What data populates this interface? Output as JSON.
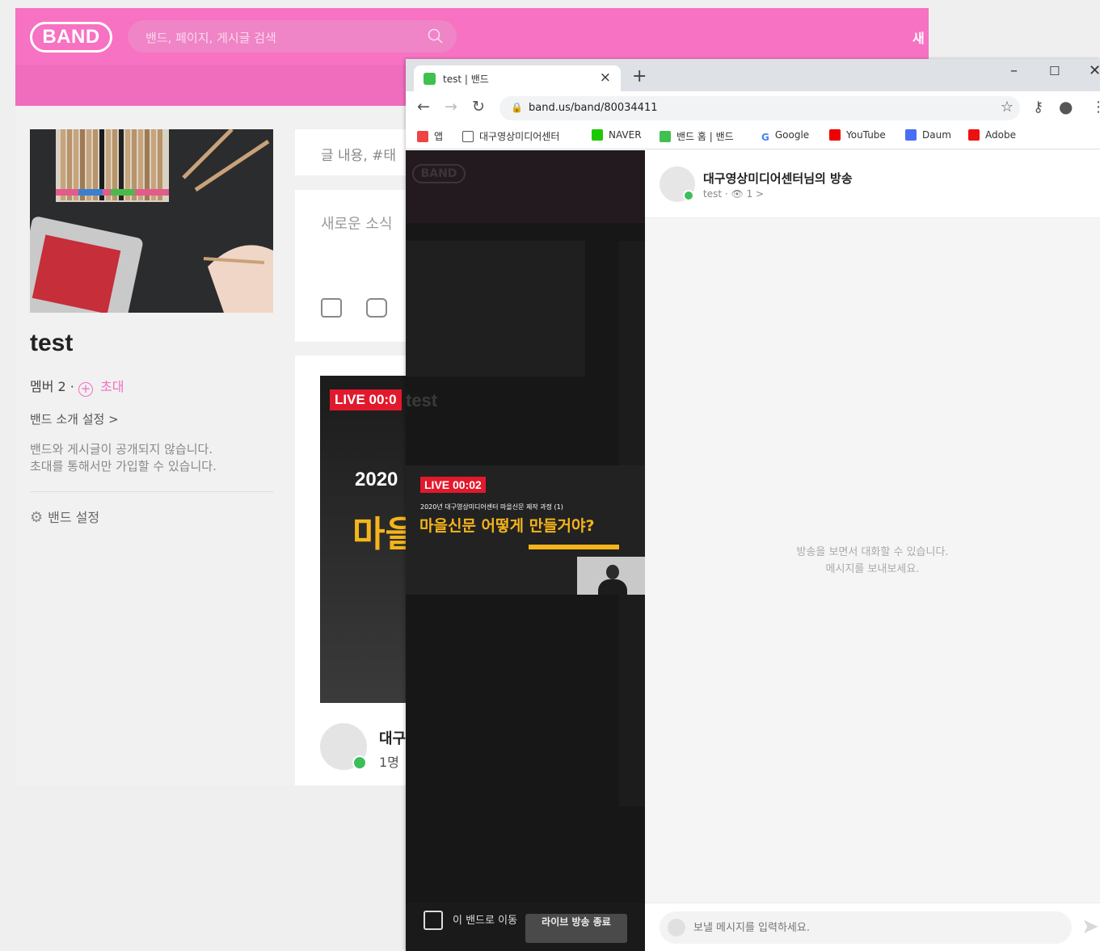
{
  "band_page": {
    "logo": "BAND",
    "search_placeholder": "밴드, 페이지, 게시글 검색",
    "header_new": "새",
    "band_name": "test",
    "members": "멤버 2 ·",
    "invite": "초대",
    "intro_link": "밴드 소개 설정 >",
    "desc_line1": "밴드와 게시글이 공개되지 않습니다.",
    "desc_line2": "초대를 통해서만 가입할 수 있습니다.",
    "settings": "밴드 설정",
    "post_search_placeholder": "글 내용, #태",
    "new_post_placeholder": "새로운 소식",
    "live_badge": "LIVE 00:0",
    "video_year": "2020",
    "video_title": "마을",
    "author_name": "대구",
    "author_count": "1명"
  },
  "browser": {
    "tab_title": "test | 밴드",
    "url": "band.us/band/80034411",
    "bookmarks": [
      "앱",
      "대구영상미디어센터",
      "NAVER",
      "밴드 홈 | 밴드",
      "Google",
      "YouTube",
      "Daum",
      "Adobe"
    ],
    "bookmark_colors": [
      "#e44",
      "#555",
      "#1ec800",
      "#3fc04f",
      "#4285f4",
      "#e00",
      "#4b6cf5",
      "#e11"
    ]
  },
  "player": {
    "ghost_logo": "BAND",
    "ghost_title": "test",
    "live_badge": "LIVE 00:02",
    "subtitle": "2020년 대구영상미디어센터 마을신문 제작 과정 (1)",
    "headline": "마을신문 어떻게 만들거야?",
    "move_label": "이 밴드로 이동",
    "end_button": "라이브 방송 종료"
  },
  "chat": {
    "title": "대구영상미디어센터님의 방송",
    "meta_band": "test ·",
    "meta_views": "1 >",
    "empty_line1": "방송을 보면서 대화할 수 있습니다.",
    "empty_line2": "메시지를 보내보세요.",
    "input_placeholder": "보낼 메시지를 입력하세요."
  }
}
